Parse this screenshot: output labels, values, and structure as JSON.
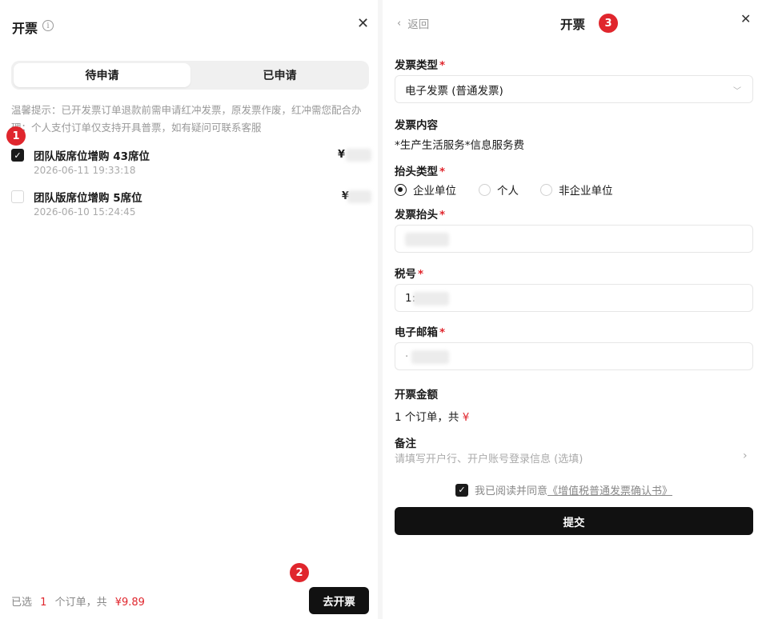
{
  "left": {
    "title": "开票",
    "info_glyph": "i",
    "close_glyph": "✕",
    "tabs": [
      {
        "label": "待申请",
        "active": true
      },
      {
        "label": "已申请",
        "active": false
      }
    ],
    "tip": "温馨提示：已开发票订单退款前需申请红冲发票，原发票作废，红冲需您配合办理；个人支付订单仅支持开具普票，如有疑问可联系客服",
    "orders": [
      {
        "name": "团队版席位增购 43席位",
        "time": "2026-06-11 19:33:18",
        "price": "¥",
        "checked": true
      },
      {
        "name": "团队版席位增购 5席位",
        "time": "2026-06-10 15:24:45",
        "price": "¥",
        "checked": false
      }
    ],
    "footer": {
      "prefix": "已选",
      "count": "1",
      "middle": "个订单，共",
      "amount": "¥9.89"
    },
    "go_button": "去开票"
  },
  "badges": {
    "one": "1",
    "two": "2",
    "three": "3"
  },
  "right": {
    "back_label": "返回",
    "back_glyph": "‹",
    "title": "开票",
    "close_glyph": "✕",
    "invoice_type": {
      "label": "发票类型",
      "value": "电子发票 (普通发票)"
    },
    "invoice_content": {
      "label": "发票内容",
      "value": "*生产生活服务*信息服务费"
    },
    "title_type": {
      "label": "抬头类型",
      "options": [
        "企业单位",
        "个人",
        "非企业单位"
      ],
      "selected": 0
    },
    "invoice_title": {
      "label": "发票抬头",
      "value": ""
    },
    "tax_no": {
      "label": "税号",
      "value": "1:"
    },
    "email": {
      "label": "电子邮箱",
      "value": "·"
    },
    "amount": {
      "label": "开票金额",
      "prefix": "1 个订单，共",
      "value": "¥"
    },
    "remark": {
      "label": "备注",
      "placeholder": "请填写开户行、开户账号登录信息 (选填)"
    },
    "agree": {
      "text": "我已阅读并同意",
      "link": "《增值税普通发票确认书》"
    },
    "required_mark": "*",
    "submit": "提交"
  },
  "colors": {
    "accent_red": "#e0262d",
    "button_dark": "#111111"
  }
}
